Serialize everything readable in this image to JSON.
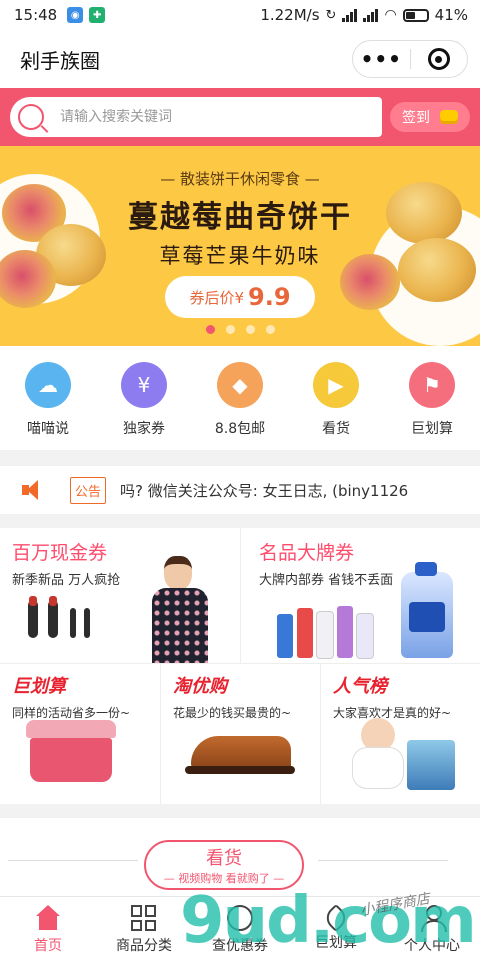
{
  "status_bar": {
    "time": "15:48",
    "network_speed": "1.22M/s",
    "battery": "41%"
  },
  "title_bar": {
    "title": "剁手族圈",
    "more_label": "•••"
  },
  "search": {
    "placeholder": "请输入搜索关键词",
    "signin_label": "签到"
  },
  "banner": {
    "subtitle": "— 散装饼干休闲零食 —",
    "title": "蔓越莓曲奇饼干",
    "flavor": "草莓芒果牛奶味",
    "price_label": "券后价¥",
    "price_value": "9.9",
    "slide_count": 4,
    "active_slide": 1
  },
  "categories": [
    {
      "label": "喵喵说",
      "icon": "cat-ear-icon",
      "color": "#5ab4f0"
    },
    {
      "label": "独家券",
      "icon": "coupon-icon",
      "color": "#8c7cf0"
    },
    {
      "label": "8.8包邮",
      "icon": "diamond-icon",
      "color": "#f5a25a"
    },
    {
      "label": "看货",
      "icon": "video-icon",
      "color": "#f5c93a"
    },
    {
      "label": "巨划算",
      "icon": "flag-icon",
      "color": "#f56e7e"
    }
  ],
  "notice": {
    "tag": "公告",
    "text": "吗? 微信关注公众号: 女王日志, (biny1126"
  },
  "promo": {
    "cash": {
      "title": "百万现金券",
      "subtitle": "新季新品 万人疯抢"
    },
    "brand": {
      "title": "名品大牌券",
      "subtitle": "大牌内部券 省钱不丢面"
    },
    "deal": {
      "title": "巨划算",
      "subtitle": "同样的活动省多一份~"
    },
    "taoyou": {
      "title": "淘优购",
      "subtitle": "花最少的钱买最贵的~"
    },
    "popular": {
      "title": "人气榜",
      "subtitle": "大家喜欢才是真的好~"
    }
  },
  "kanhuo": {
    "title": "看货",
    "subtitle": "— 视频购物 看就购了 —"
  },
  "tabbar": [
    {
      "label": "首页",
      "icon": "home-icon",
      "active": true
    },
    {
      "label": "商品分类",
      "icon": "grid-icon",
      "active": false
    },
    {
      "label": "查优惠券",
      "icon": "ticket-icon",
      "active": false
    },
    {
      "label": "巨划算",
      "icon": "tag-icon",
      "active": false
    },
    {
      "label": "个人中心",
      "icon": "user-icon",
      "active": false
    }
  ],
  "watermark": {
    "text": "9ud.com",
    "small_text": "小程序商店"
  },
  "colors": {
    "brand_pink": "#f2566f",
    "banner_yellow": "#fdc944",
    "promo_red": "#ff4d6d"
  }
}
